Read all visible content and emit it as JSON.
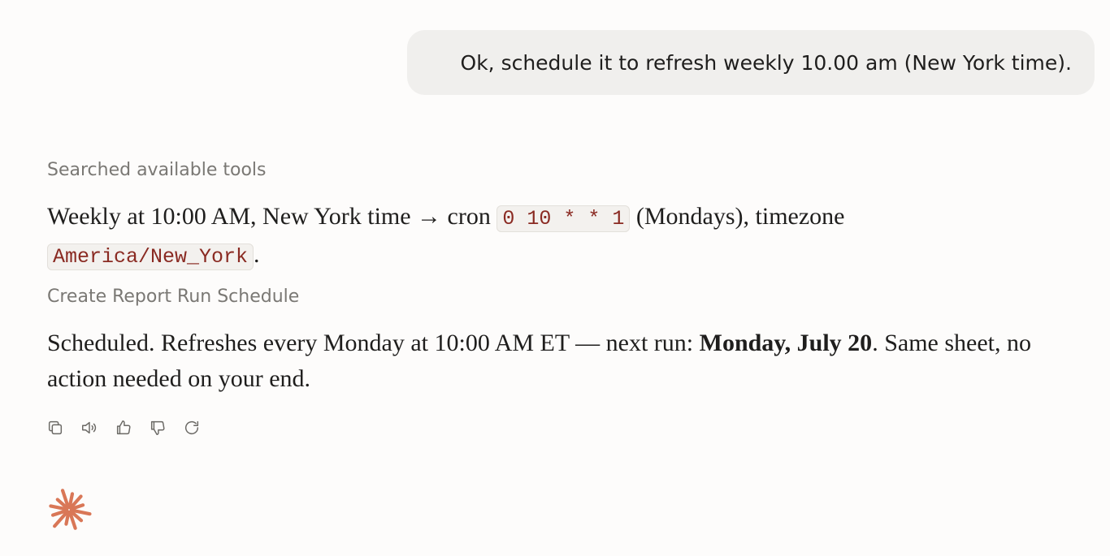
{
  "user_message": "Ok, schedule it to refresh weekly 10.00 am (New York time).",
  "assistant": {
    "status_1": "Searched available tools",
    "para_1": {
      "text_a": "Weekly at 10:00 AM, New York time → cron ",
      "code_cron": "0 10 * * 1",
      "text_b": " (Mondays), timezone ",
      "code_tz": "America/New_York",
      "text_c": "."
    },
    "status_2": "Create Report Run Schedule",
    "para_2": {
      "text_a": "Scheduled. Refreshes every Monday at 10:00 AM ET — next run: ",
      "bold": "Monday, July 20",
      "text_b": ". Same sheet, no action needed on your end."
    }
  },
  "actions": [
    {
      "icon": "copy-icon"
    },
    {
      "icon": "speaker-icon"
    },
    {
      "icon": "thumbs-up-icon"
    },
    {
      "icon": "thumbs-down-icon"
    },
    {
      "icon": "retry-icon"
    }
  ],
  "colors": {
    "accent": "#d97757",
    "code_text": "#8a2a22",
    "muted_text": "#7a7874",
    "bubble_bg": "#f0efed",
    "page_bg": "#fdfcfb"
  }
}
